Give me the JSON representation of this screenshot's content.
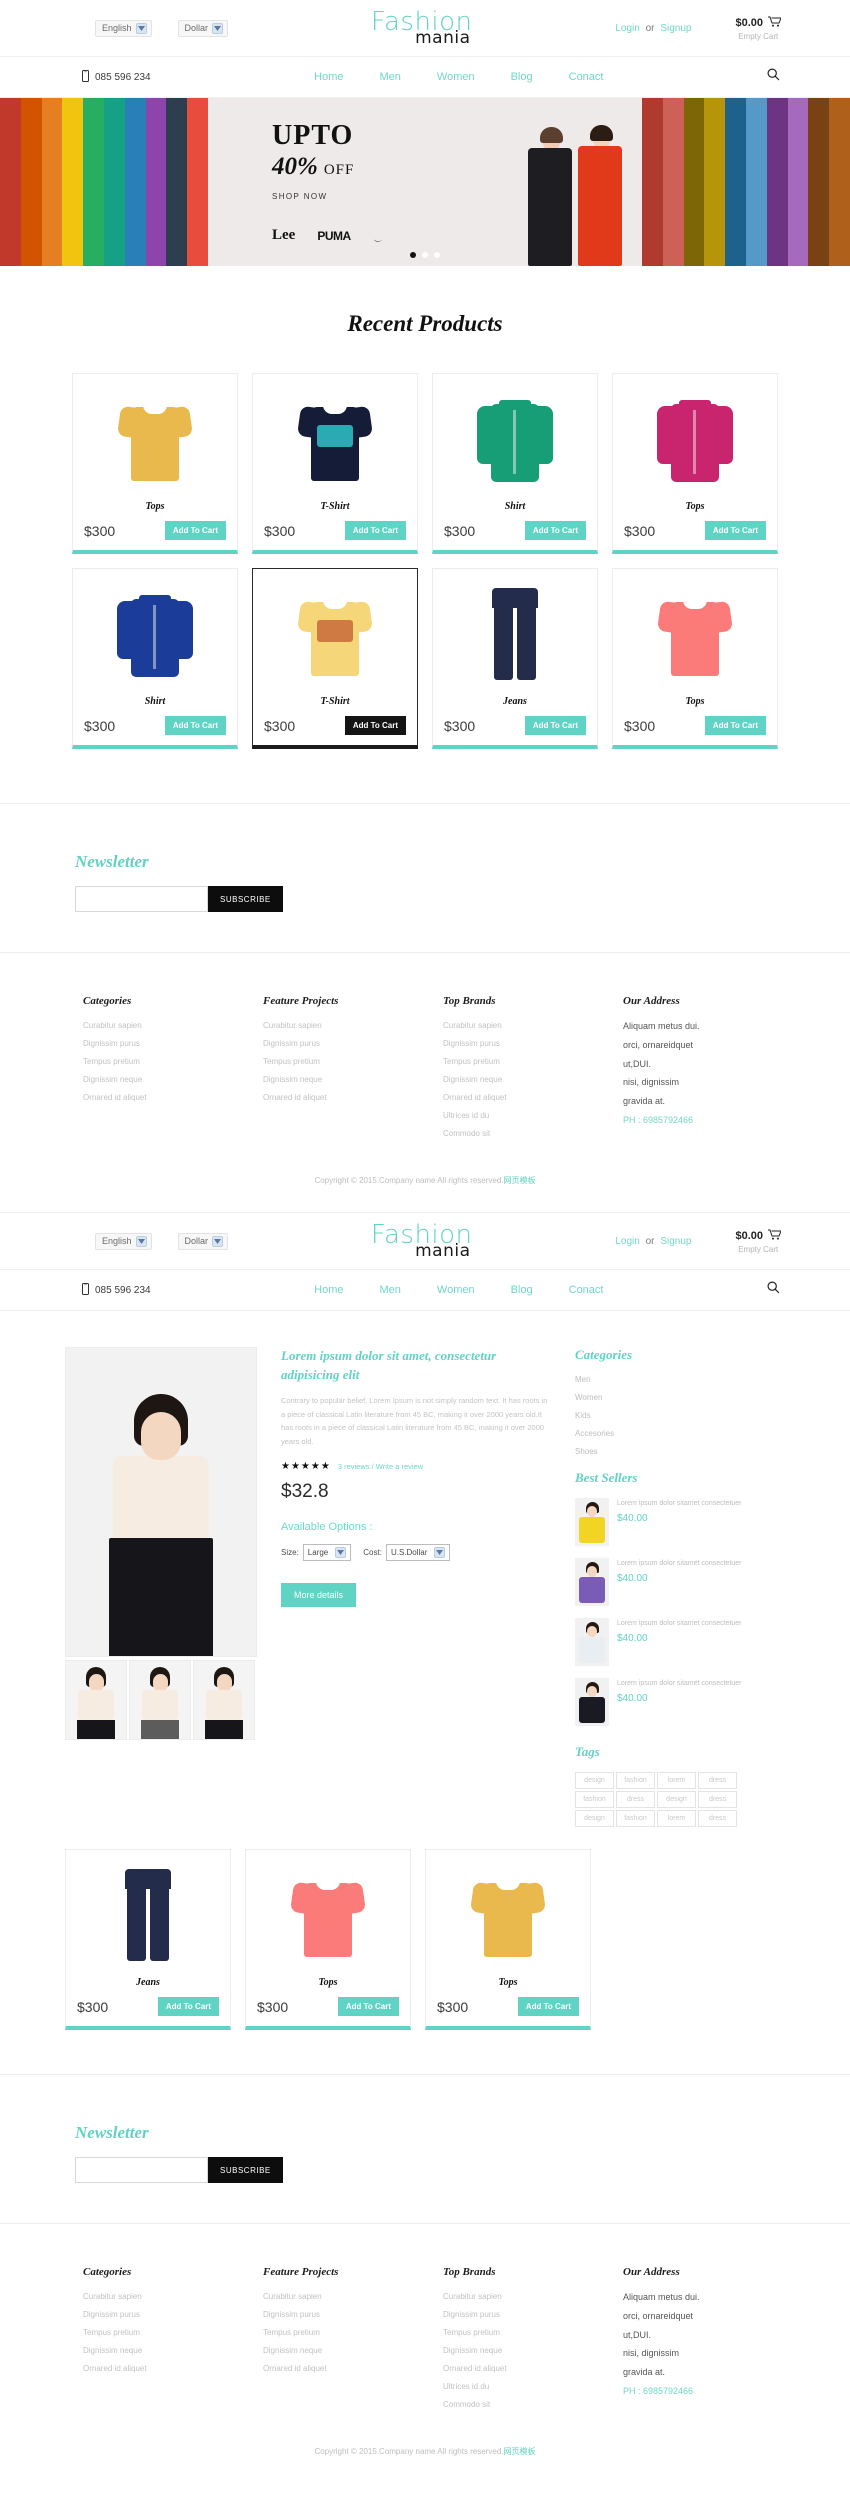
{
  "brand": {
    "top": "Fashion",
    "bottom": "mania",
    "accent": "#5fd3c4"
  },
  "topbar": {
    "language": "English",
    "currency": "Dollar",
    "login": "Login",
    "or": "or",
    "signup": "Signup",
    "cart_amount": "$0.00",
    "cart_status": "Empty Cart"
  },
  "nav": {
    "phone": "085 596 234",
    "links": [
      "Home",
      "Men",
      "Women",
      "Blog",
      "Conact"
    ],
    "search_icon": "search-icon"
  },
  "hero": {
    "upto": "UPTO",
    "percent": "40%",
    "off": "OFF",
    "shop_now": "SHOP NOW",
    "brands": [
      "Lee",
      "PUMA",
      "nike-swoosh"
    ],
    "slides": 3,
    "active_slide": 1
  },
  "recent": {
    "title": "Recent Products",
    "products": [
      {
        "name": "Tops",
        "price": "$300",
        "cta": "Add To Cart",
        "kind": "tee",
        "color": "#e9b94e",
        "print": "",
        "hovered": false
      },
      {
        "name": "T-Shirt",
        "price": "$300",
        "cta": "Add To Cart",
        "kind": "tee",
        "color": "#141c38",
        "print": "#2fc3c9",
        "hovered": false
      },
      {
        "name": "Shirt",
        "price": "$300",
        "cta": "Add To Cart",
        "kind": "longsleeve",
        "color": "#189e76",
        "print": "",
        "hovered": false
      },
      {
        "name": "Tops",
        "price": "$300",
        "cta": "Add To Cart",
        "kind": "longsleeve",
        "color": "#c9256e",
        "print": "",
        "hovered": false
      },
      {
        "name": "Shirt",
        "price": "$300",
        "cta": "Add To Cart",
        "kind": "longsleeve",
        "color": "#1b3c99",
        "print": "",
        "hovered": false
      },
      {
        "name": "T-Shirt",
        "price": "$300",
        "cta": "Add To Cart",
        "kind": "tee",
        "color": "#f5d77a",
        "print": "#c96a3a",
        "hovered": true
      },
      {
        "name": "Jeans",
        "price": "$300",
        "cta": "Add To Cart",
        "kind": "pants",
        "color": "#232c4a",
        "print": "",
        "hovered": false
      },
      {
        "name": "Tops",
        "price": "$300",
        "cta": "Add To Cart",
        "kind": "tee",
        "color": "#fa7b79",
        "print": "#fa7b79",
        "hovered": false
      }
    ]
  },
  "newsletter": {
    "title": "Newsletter",
    "placeholder": "",
    "value": "",
    "button": "SUBSCRIBE"
  },
  "footer": {
    "columns": [
      {
        "title": "Categories",
        "items": [
          "Curabitur sapien",
          "Dignissim purus",
          "Tempus pretium",
          "Dignissim neque",
          "Ornared id aliquet"
        ]
      },
      {
        "title": "Feature Projects",
        "items": [
          "Curabitur sapien",
          "Dignissim purus",
          "Tempus pretium",
          "Dignissim neque",
          "Ornared id aliquet"
        ]
      },
      {
        "title": "Top Brands",
        "items": [
          "Curabitur sapien",
          "Dignissim purus",
          "Tempus pretium",
          "Dignissim neque",
          "Ornared id aliquet",
          "Ultrices id du",
          "Commodo sit"
        ]
      }
    ],
    "address": {
      "title": "Our Address",
      "lines": [
        "Aliquam metus dui.",
        "orci, ornareidquet",
        "ut,DUI.",
        "nisi, dignissim",
        "gravida at."
      ],
      "phone": "PH : 6985792466"
    },
    "copyright": "Copyright © 2015.Company name All rights reserved.",
    "copyright_cn": "网页模板"
  },
  "detail": {
    "title": "Lorem ipsum dolor sit amet, consectetur adipisicing elit",
    "description": "Contrary to popular belief, Lorem Ipsum is not simply random text. It has roots in a piece of classical Latin literature from 45 BC, making it over 2000 years old.It has roots in a piece of classical Latin literature from 45 BC, making it over 2000 years old.",
    "stars": "★★★★★",
    "reviews": "3 reviews / Write a review",
    "price": "$32.8",
    "options_title": "Available Options :",
    "size_label": "Size:",
    "size_value": "Large",
    "cost_label": "Cost:",
    "cost_value": "U.S.Dollar",
    "more_details": "More details",
    "thumbnails": 3
  },
  "sidebar": {
    "categories_title": "Categories",
    "categories": [
      "Men",
      "Women",
      "Kids",
      "Accesories",
      "Shoes"
    ],
    "best_sellers_title": "Best Sellers",
    "best_sellers": [
      {
        "text": "Lorem ipsum dolor sitamet consectetuer",
        "price": "$40.00",
        "color": "#f2d522"
      },
      {
        "text": "Lorem ipsum dolor sitamet consectetuer",
        "price": "$40.00",
        "color": "#7a5bb8"
      },
      {
        "text": "Lorem ipsum dolor sitamet consectetuer",
        "price": "$40.00",
        "color": "#e9eef3"
      },
      {
        "text": "Lorem ipsum dolor sitamet consectetuer",
        "price": "$40.00",
        "color": "#1a1a22"
      }
    ],
    "tags_title": "Tags",
    "tags": [
      "design",
      "fashion",
      "lorem",
      "dress",
      "fashion",
      "dress",
      "design",
      "dress",
      "design",
      "fashion",
      "lorem",
      "dress"
    ]
  },
  "detail_products": [
    {
      "name": "Jeans",
      "price": "$300",
      "cta": "Add To Cart",
      "kind": "pants",
      "color": "#232c4a"
    },
    {
      "name": "Tops",
      "price": "$300",
      "cta": "Add To Cart",
      "kind": "tee",
      "color": "#fa7b79",
      "print": "#fa7b79"
    },
    {
      "name": "Tops",
      "price": "$300",
      "cta": "Add To Cart",
      "kind": "tee",
      "color": "#e9b94e"
    }
  ]
}
